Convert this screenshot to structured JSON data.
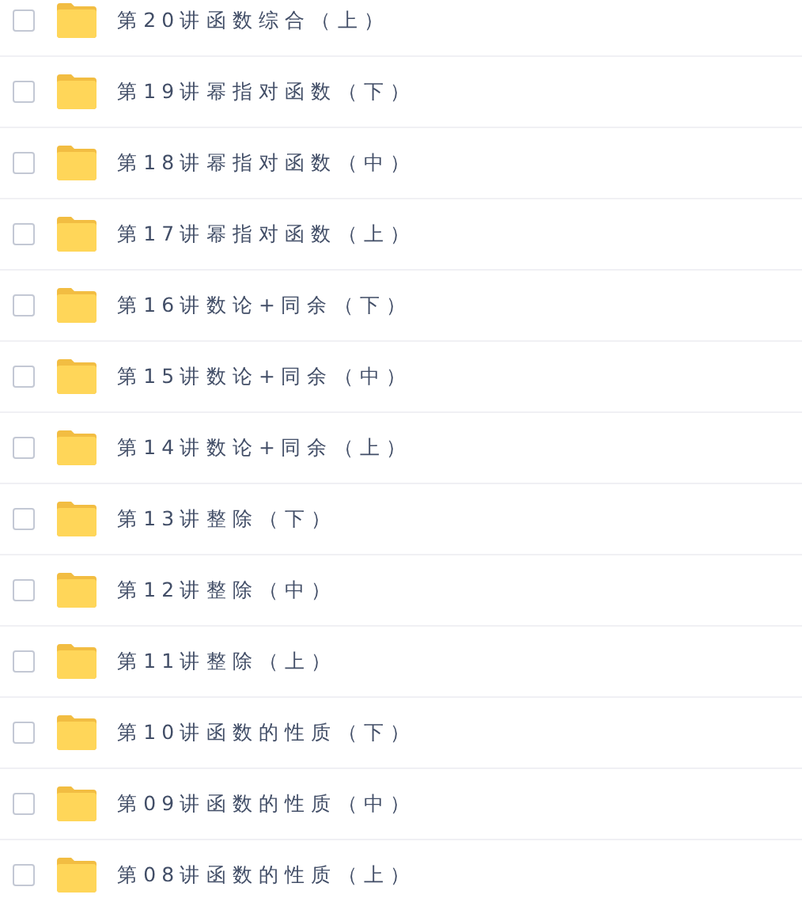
{
  "files": [
    {
      "name": "第20讲函数综合（上）",
      "checked": false
    },
    {
      "name": "第19讲幂指对函数（下）",
      "checked": false
    },
    {
      "name": "第18讲幂指对函数（中）",
      "checked": false
    },
    {
      "name": "第17讲幂指对函数（上）",
      "checked": false
    },
    {
      "name": "第16讲数论+同余（下）",
      "checked": false
    },
    {
      "name": "第15讲数论+同余（中）",
      "checked": false
    },
    {
      "name": "第14讲数论+同余（上）",
      "checked": false
    },
    {
      "name": "第13讲整除（下）",
      "checked": false
    },
    {
      "name": "第12讲整除（中）",
      "checked": false
    },
    {
      "name": "第11讲整除（上）",
      "checked": false
    },
    {
      "name": "第10讲函数的性质（下）",
      "checked": false
    },
    {
      "name": "第09讲函数的性质（中）",
      "checked": false
    },
    {
      "name": "第08讲函数的性质（上）",
      "checked": false
    }
  ]
}
